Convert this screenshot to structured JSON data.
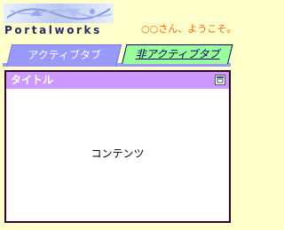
{
  "header": {
    "logo_text": "Portalworks",
    "welcome_text": "○○さん、ようこそ。"
  },
  "tabs": [
    {
      "label": "アクティブタブ",
      "active": true
    },
    {
      "label": "非アクティブタブ",
      "active": false
    }
  ],
  "portlet": {
    "title": "タイトル",
    "content": "コンテンツ",
    "button_icon": "window-icon"
  },
  "colors": {
    "background": "#ffffcc",
    "active_tab": "#9999ff",
    "inactive_tab": "#99ff99",
    "title_bar": "#cc99ff",
    "welcome": "#ff6600",
    "portlet_border": "#330033"
  }
}
